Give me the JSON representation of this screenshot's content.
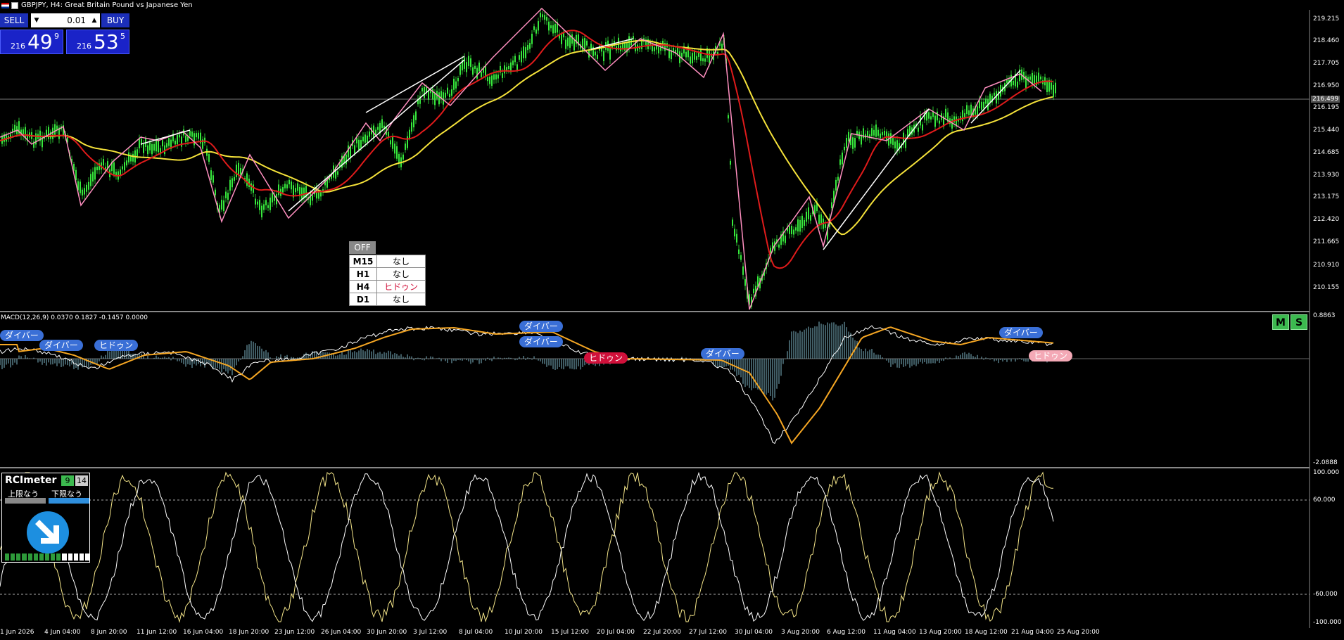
{
  "window": {
    "title": "GBPJPY, H4:  Great Britain Pound vs Japanese Yen",
    "symbol": "GBPJPY",
    "timeframe": "H4"
  },
  "trade_panel": {
    "sell_label": "SELL",
    "buy_label": "BUY",
    "lot_value": "0.01",
    "bid_prefix": "216",
    "bid_big": "49",
    "bid_sup": "9",
    "ask_prefix": "216",
    "ask_big": "53",
    "ask_sup": "5"
  },
  "price_axis": {
    "labels": [
      "219.215",
      "218.460",
      "217.705",
      "216.950",
      "216.195",
      "215.440",
      "214.685",
      "213.930",
      "213.175",
      "212.420",
      "211.665",
      "210.910",
      "210.155"
    ],
    "current_price": "216.499"
  },
  "signal_table": {
    "off_label": "OFF",
    "rows": [
      {
        "tf": "M15",
        "value": "なし",
        "color": "#000000"
      },
      {
        "tf": "H1",
        "value": "なし",
        "color": "#000000"
      },
      {
        "tf": "H4",
        "value": "ヒドゥン",
        "color": "#d0103a"
      },
      {
        "tf": "D1",
        "value": "なし",
        "color": "#000000"
      }
    ]
  },
  "macd": {
    "label": "MACD(12,26,9) 0.0370 0.1827 -0.1457 0.0000",
    "axis_top": "0.8863",
    "axis_bottom": "-2.0888",
    "tags": {
      "t1": "ダイバー",
      "t2": "ダイバー",
      "t3": "ヒドゥン",
      "t4": "ダイバー",
      "t5": "ダイバー",
      "t6": "ヒドゥン",
      "t7": "ダイバー",
      "t8": "ダイバー",
      "t9": "ヒドゥン"
    },
    "m_label": "M",
    "s_label": "S"
  },
  "rci": {
    "title": "RCImeter",
    "period1": "9",
    "period2": "14",
    "upper_label": "上限なう",
    "lower_label": "下限なう",
    "axis": [
      "100.000",
      "60.000",
      "-60.000",
      "-100.000"
    ],
    "strength_filled": 10,
    "strength_total": 15
  },
  "time_axis": {
    "labels": [
      "1 Jun 2026",
      "4 Jun 04:00",
      "8 Jun 20:00",
      "11 Jun 12:00",
      "16 Jun 04:00",
      "18 Jun 20:00",
      "23 Jun 12:00",
      "26 Jun 04:00",
      "30 Jun 20:00",
      "3 Jul 12:00",
      "8 Jul 04:00",
      "10 Jul 20:00",
      "15 Jul 12:00",
      "20 Jul 04:00",
      "22 Jul 20:00",
      "27 Jul 12:00",
      "30 Jul 04:00",
      "3 Aug 20:00",
      "6 Aug 12:00",
      "11 Aug 04:00",
      "13 Aug 20:00",
      "18 Aug 12:00",
      "21 Aug 04:00",
      "25 Aug 20:00"
    ]
  },
  "colors": {
    "candle": "#37e83d",
    "ma_fast": "#e01b1b",
    "ma_mid": "#2aa8ff",
    "ma_slow": "#f5e23a",
    "zigzag": "#ff8fc0",
    "trend_line": "#ffffff",
    "macd_signal": "#f5a623",
    "rci_line": "#f5e68a"
  }
}
